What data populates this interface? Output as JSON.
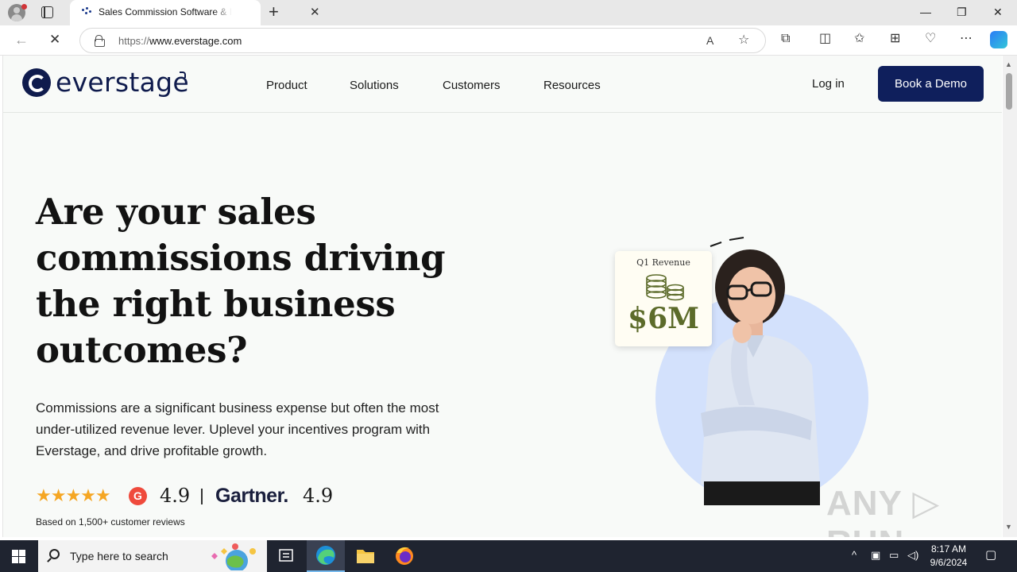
{
  "browser": {
    "tab_title": "Sales Commission Software & Incentive",
    "tab_close": "✕",
    "new_tab": "+",
    "url_scheme": "https://",
    "url_host": "www.everstage.com",
    "window": {
      "minimize": "—",
      "restore": "❐",
      "close": "✕"
    }
  },
  "site": {
    "logo_text": "everstage",
    "nav": [
      "Product",
      "Solutions",
      "Customers",
      "Resources"
    ],
    "login": "Log in",
    "cta": "Book a Demo"
  },
  "hero": {
    "title": "Are your sales commissions driving the right business outcomes?",
    "subtitle": "Commissions are a significant business expense but often the most under-utilized revenue lever. Uplevel your incentives program with Everstage, and drive profitable growth.",
    "stars": "★★★★★",
    "g2_label": "G",
    "g2_rating": "4.9",
    "gartner_label": "Gartner.",
    "gartner_rating": "4.9",
    "reviews_note": "Based on 1,500+ customer reviews",
    "card_title": "Q1 Revenue",
    "card_value": "$6M"
  },
  "watermark": "ANY ▷ RUN",
  "taskbar": {
    "search_placeholder": "Type here to search",
    "time": "8:17 AM",
    "date": "9/6/2024"
  },
  "colors": {
    "brand_navy": "#0f1f5c",
    "star_gold": "#f5a623",
    "g2_red": "#ef4a3c",
    "hero_circle": "#d3e1fc",
    "card_value_olive": "#5c6b2a"
  }
}
